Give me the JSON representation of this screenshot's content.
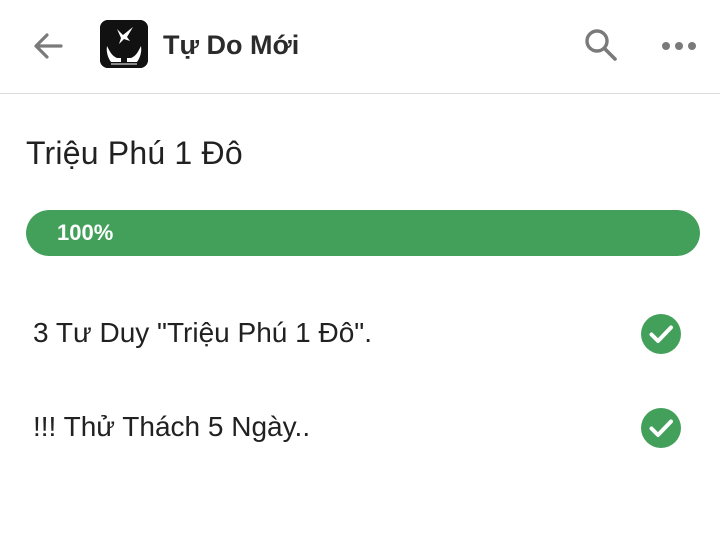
{
  "appbar": {
    "title": "Tự Do Mới",
    "icons": {
      "back": "arrow-back-icon",
      "logo": "app-logo-icon",
      "search": "search-icon",
      "more": "more-horizontal-icon"
    }
  },
  "course": {
    "title": "Triệu Phú 1 Đô",
    "progress": {
      "label": "100%",
      "percent": 100
    }
  },
  "lessons": [
    {
      "title": "3 Tư Duy \"Triệu Phú 1 Đô\".",
      "completed": true
    },
    {
      "title": "!!! Thử Thách 5 Ngày..",
      "completed": true
    }
  ],
  "colors": {
    "accent": "#43a05b",
    "track": "#e0e0e0",
    "icon": "#757575"
  }
}
